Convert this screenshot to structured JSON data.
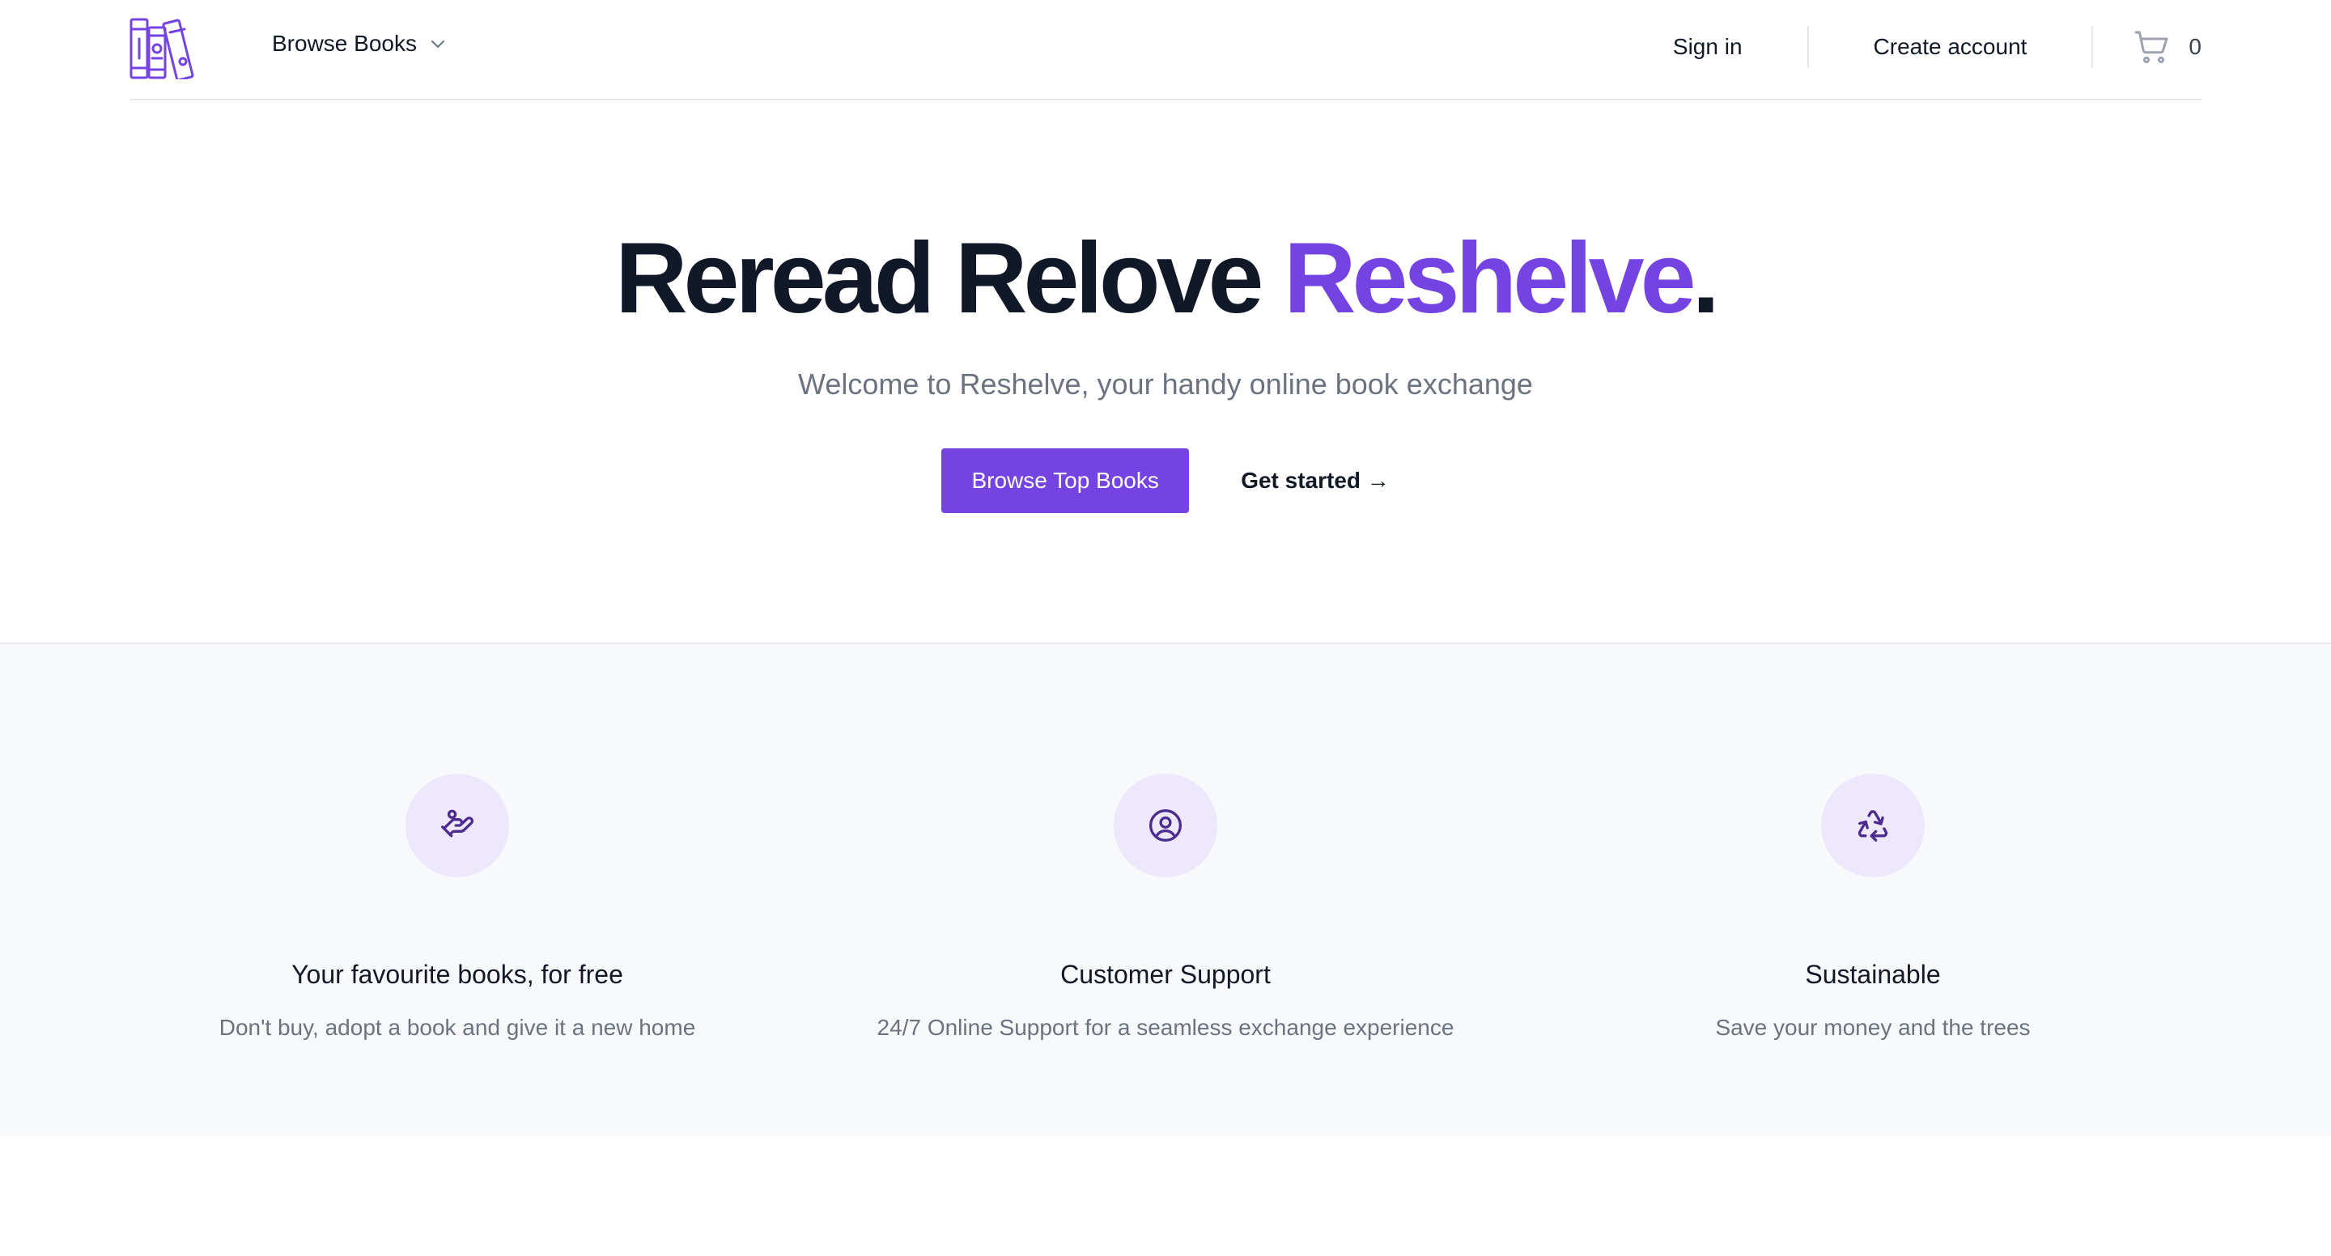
{
  "colors": {
    "accent": "#7443e2",
    "text": "#111827",
    "muted": "#6b7280",
    "feature_bg": "#f8f9fb",
    "icon_bg": "#ede8fb"
  },
  "nav": {
    "logo_icon": "books-icon",
    "browse_label": "Browse Books",
    "browse_icon": "chevron-down-icon",
    "sign_in_label": "Sign in",
    "create_account_label": "Create account",
    "cart_icon": "shopping-cart-icon",
    "cart_count": "0"
  },
  "hero": {
    "title_part1": "Reread Relove ",
    "title_accent": "Reshelve",
    "title_end": ".",
    "subtitle": "Welcome to Reshelve, your handy online book exchange",
    "primary_button": "Browse Top Books",
    "secondary_link": "Get started →"
  },
  "features": [
    {
      "icon": "hand-heart-icon",
      "title": "Your favourite books, for free",
      "text": "Don't buy, adopt a book and give it a new home"
    },
    {
      "icon": "user-circle-icon",
      "title": "Customer Support",
      "text": "24/7 Online Support for a seamless exchange experience"
    },
    {
      "icon": "recycle-icon",
      "title": "Sustainable",
      "text": "Save your money and the trees"
    }
  ]
}
